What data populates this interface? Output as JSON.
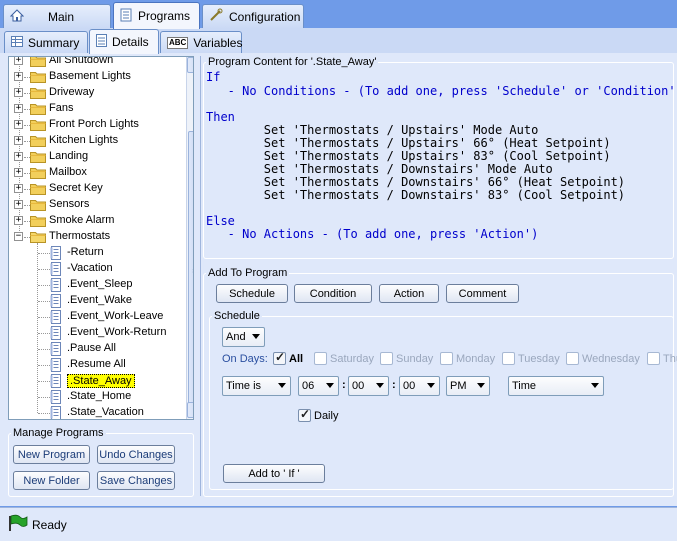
{
  "tabs": {
    "main": "Main",
    "programs": "Programs",
    "configuration": "Configuration"
  },
  "subtabs": {
    "summary": "Summary",
    "details": "Details",
    "variables": "Variables",
    "variables_icon_text": "ABC"
  },
  "tree": {
    "top_partial": "All Shutdown",
    "folders": [
      "Basement Lights",
      "Driveway",
      "Fans",
      "Front Porch Lights",
      "Kitchen Lights",
      "Landing",
      "Mailbox",
      "Secret Key",
      "Sensors",
      "Smoke Alarm",
      "Thermostats"
    ],
    "programs": [
      "-Return",
      "-Vacation",
      ".Event_Sleep",
      ".Event_Wake",
      ".Event_Work-Leave",
      ".Event_Work-Return",
      ".Pause All",
      ".Resume All",
      ".State_Away",
      ".State_Home",
      ".State_Vacation"
    ],
    "selected": ".State_Away"
  },
  "manage": {
    "title": "Manage Programs",
    "new_program": "New Program",
    "undo_changes": "Undo Changes",
    "new_folder": "New Folder",
    "save_changes": "Save Changes"
  },
  "program_content": {
    "title": "Program Content for '.State_Away'",
    "if_kw": "If",
    "if_line": "   - No Conditions - (To add one, press 'Schedule' or 'Condition')",
    "then_kw": "Then",
    "then_lines": [
      "        Set 'Thermostats / Upstairs' Mode Auto",
      "        Set 'Thermostats / Upstairs' 66° (Heat Setpoint)",
      "        Set 'Thermostats / Upstairs' 83° (Cool Setpoint)",
      "        Set 'Thermostats / Downstairs' Mode Auto",
      "        Set 'Thermostats / Downstairs' 66° (Heat Setpoint)",
      "        Set 'Thermostats / Downstairs' 83° (Cool Setpoint)"
    ],
    "else_kw": "Else",
    "else_line": "   - No Actions - (To add one, press 'Action')"
  },
  "add_to_program": {
    "title": "Add To Program",
    "schedule": "Schedule",
    "condition": "Condition",
    "action": "Action",
    "comment": "Comment"
  },
  "schedule": {
    "title": "Schedule",
    "logic": "And",
    "on_days": "On Days:",
    "all": "All",
    "days": [
      "Saturday",
      "Sunday",
      "Monday",
      "Tuesday",
      "Wednesday",
      "Thu"
    ],
    "time_mode": "Time is",
    "hour": "06",
    "minute": "00",
    "second": "00",
    "ampm": "PM",
    "time_type": "Time",
    "daily": "Daily",
    "add_button": "Add to ' If '"
  },
  "status": {
    "text": "Ready"
  },
  "colors": {
    "background": "#6f9be8",
    "panel": "#dfe8fa",
    "keyword": "#0000cc",
    "selection": "#ffff00"
  }
}
